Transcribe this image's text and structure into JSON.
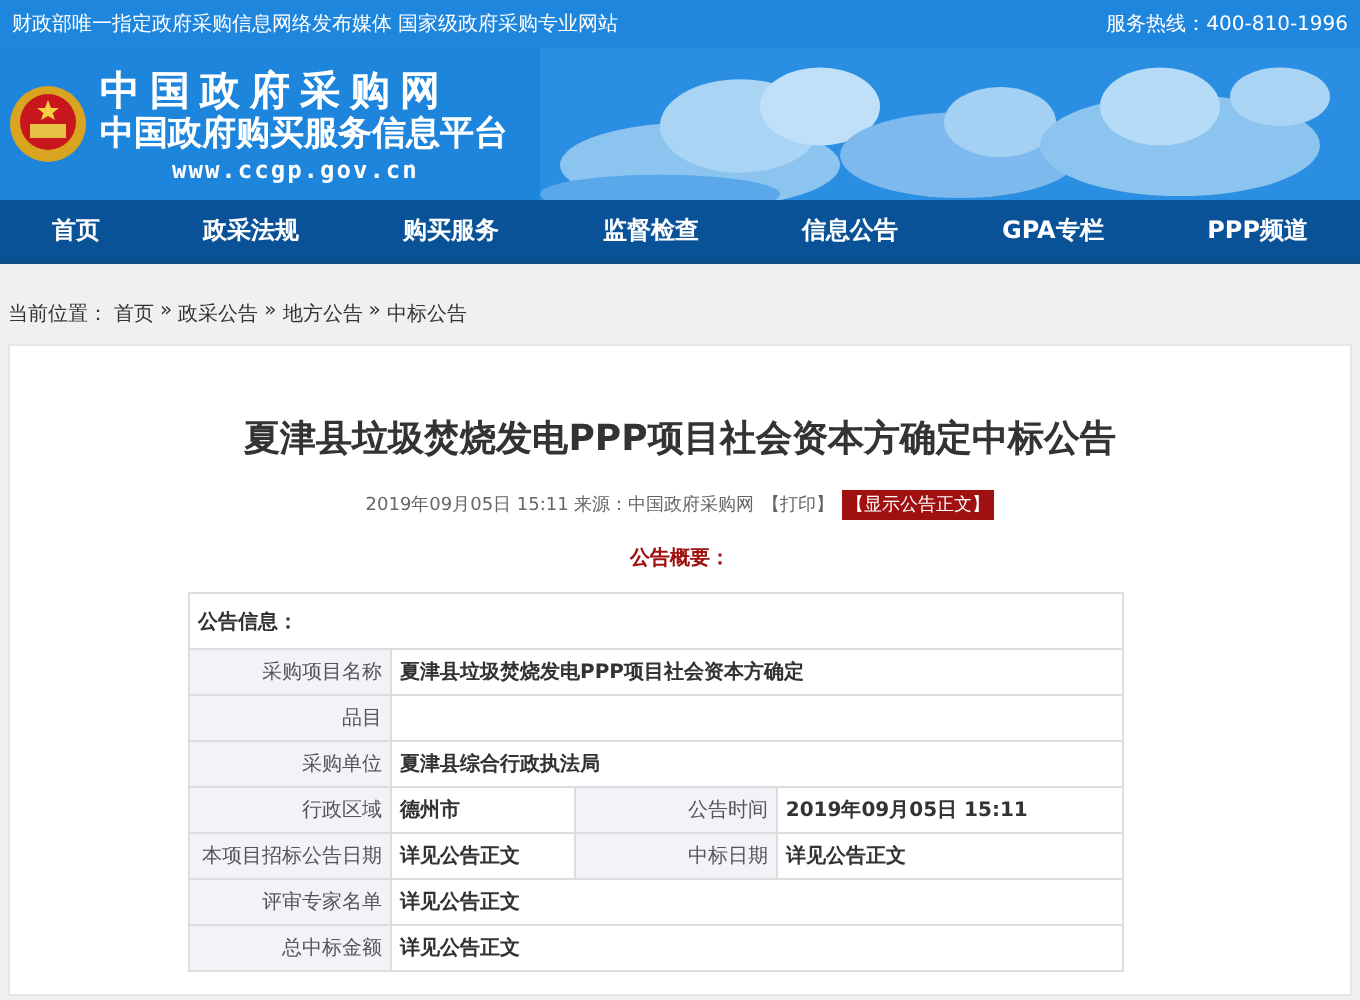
{
  "top_bar": {
    "tagline": "财政部唯一指定政府采购信息网络发布媒体 国家级政府采购专业网站",
    "hotline": "服务热线：400-810-1996"
  },
  "logo": {
    "title": "中国政府采购网",
    "subtitle": "中国政府购买服务信息平台",
    "url": "www.ccgp.gov.cn"
  },
  "nav": [
    {
      "label": "首页",
      "selected": false
    },
    {
      "label": "政采法规",
      "selected": false
    },
    {
      "label": "购买服务",
      "selected": false
    },
    {
      "label": "监督检查",
      "selected": false
    },
    {
      "label": "信息公告",
      "selected": false
    },
    {
      "label": "GPA专栏",
      "selected": false
    },
    {
      "label": "PPP频道",
      "selected": false
    }
  ],
  "breadcrumb": {
    "prefix": "当前位置：",
    "items": [
      "首页",
      "政采公告",
      "地方公告",
      "中标公告"
    ],
    "separator": "»"
  },
  "article": {
    "title": "夏津县垃圾焚烧发电PPP项目社会资本方确定中标公告",
    "meta": "2019年09月05日 15:11 来源：中国政府采购网",
    "print": "【打印】",
    "show_full": "【显示公告正文】",
    "summary_heading": "公告概要："
  },
  "table": {
    "heading": "公告信息：",
    "rows": [
      {
        "kind": "single",
        "cells": [
          {
            "label": "采购项目名称",
            "value": "夏津县垃圾焚烧发电PPP项目社会资本方确定"
          }
        ]
      },
      {
        "kind": "single",
        "cells": [
          {
            "label": "品目"
          }
        ]
      },
      {
        "kind": "single",
        "cells": [
          {
            "label": "采购单位",
            "value": "夏津县综合行政执法局"
          }
        ]
      },
      {
        "kind": "double",
        "cells": [
          {
            "label": "行政区域",
            "value": "德州市"
          },
          {
            "label": "公告时间",
            "value": "2019年09月05日 15:11"
          }
        ]
      },
      {
        "kind": "double",
        "cells": [
          {
            "label": "本项目招标公告日期",
            "value": "详见公告正文"
          },
          {
            "label": "中标日期",
            "value": "详见公告正文"
          }
        ]
      },
      {
        "kind": "single",
        "cells": [
          {
            "label": "评审专家名单",
            "value": "详见公告正文"
          }
        ]
      },
      {
        "kind": "single",
        "cells": [
          {
            "label": "总中标金额",
            "value": "详见公告正文"
          }
        ]
      }
    ]
  }
}
